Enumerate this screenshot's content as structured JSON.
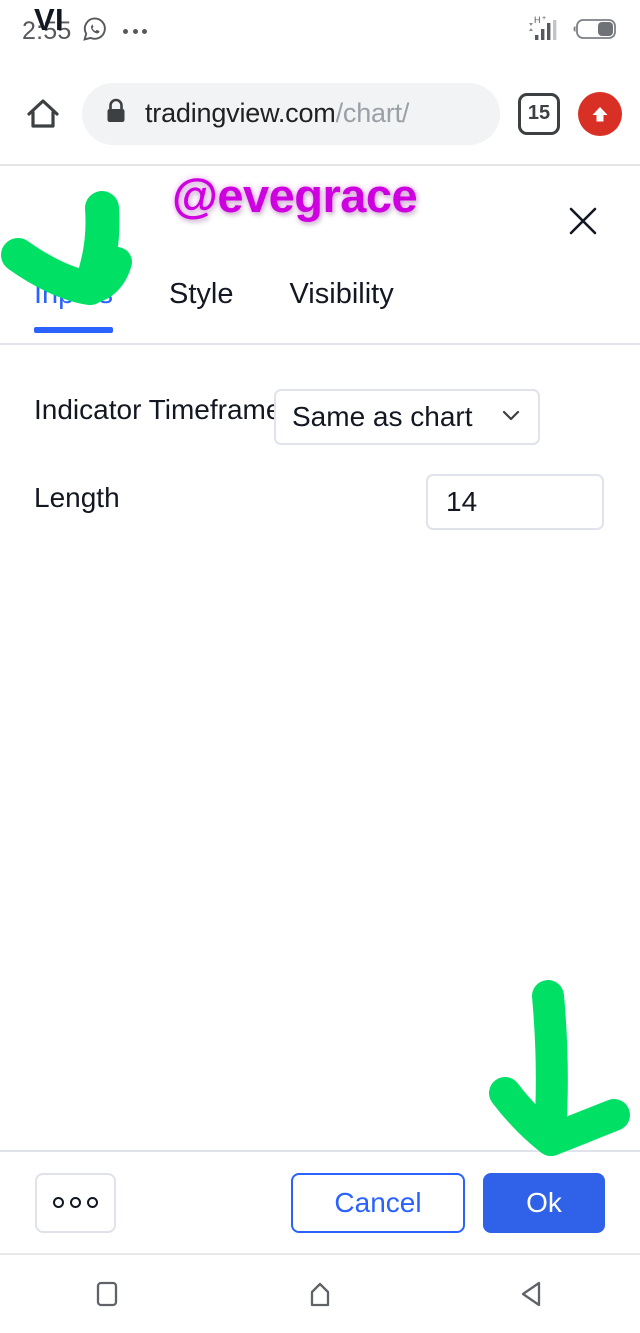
{
  "status_bar": {
    "time": "2:55",
    "icons": [
      "whatsapp-icon",
      "notification-dots",
      "signal-bars",
      "battery"
    ],
    "network_label": "H+",
    "notification_dot_count": 3
  },
  "browser": {
    "home_icon": "home-icon",
    "lock_icon": "lock-icon",
    "url_domain": "tradingview.com",
    "url_path": "/chart/",
    "tab_count": "15",
    "update_icon": "up-arrow-icon"
  },
  "dialog": {
    "title": "VI",
    "close_icon": "close-icon",
    "tabs": [
      {
        "label": "Inputs",
        "active": true
      },
      {
        "label": "Style",
        "active": false
      },
      {
        "label": "Visibility",
        "active": false
      }
    ],
    "fields": [
      {
        "label": "Indicator Timeframe",
        "type": "select",
        "value": "Same as chart",
        "chevron_icon": "chevron-down-icon"
      },
      {
        "label": "Length",
        "type": "number",
        "value": "14"
      }
    ],
    "footer": {
      "more_label": "ooo",
      "cancel_label": "Cancel",
      "ok_label": "Ok"
    }
  },
  "nav_bar": {
    "recents_icon": "square-recents-icon",
    "home_icon": "home-pentagon-icon",
    "back_icon": "back-triangle-icon"
  },
  "annotations": {
    "watermark": "@evegrace",
    "watermark_color": "#cf00e0",
    "arrow_color": "#00e065",
    "arrows": [
      {
        "name": "arrow-pointing-inputs-tab"
      },
      {
        "name": "arrow-pointing-ok-button"
      }
    ]
  },
  "colors": {
    "accent_blue": "#2962ff",
    "ok_button_blue": "#2f62e8",
    "border_gray": "#e0e3eb",
    "text_dark": "#131722",
    "url_gray": "#9aa0a6",
    "update_red": "#d93025"
  }
}
